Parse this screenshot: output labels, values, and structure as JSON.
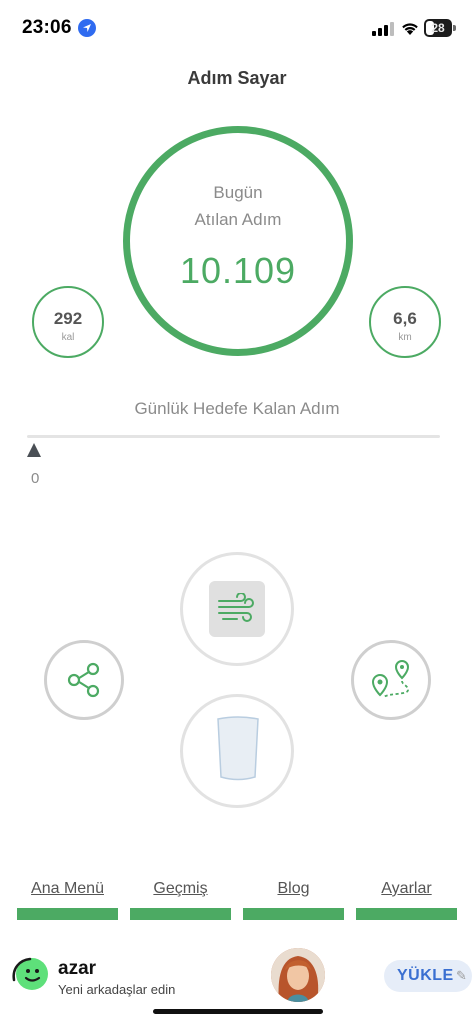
{
  "status_bar": {
    "time": "23:06",
    "battery": "28"
  },
  "header": {
    "title": "Adım Sayar"
  },
  "steps": {
    "label_line1": "Bugün",
    "label_line2": "Atılan Adım",
    "value": "10.109"
  },
  "calories": {
    "value": "292",
    "unit": "kal"
  },
  "distance": {
    "value": "6,6",
    "unit": "km"
  },
  "goal": {
    "label": "Günlük Hedefe Kalan Adım",
    "remaining": "0",
    "progress_fraction": 0
  },
  "actions": {
    "share": {
      "icon": "share-icon"
    },
    "breathe": {
      "icon": "wind-icon"
    },
    "route": {
      "icon": "route-pin-icon"
    },
    "water": {
      "icon": "water-glass-icon"
    }
  },
  "nav": {
    "home": "Ana Menü",
    "history": "Geçmiş",
    "blog": "Blog",
    "settings": "Ayarlar"
  },
  "ad": {
    "title": "azar",
    "subtitle": "Yeni arkadaşlar edin",
    "install_label": "YÜKLE"
  },
  "colors": {
    "accent": "#4caa63",
    "text_muted": "#8b8b8b",
    "install_blue": "#3a6fd1"
  }
}
